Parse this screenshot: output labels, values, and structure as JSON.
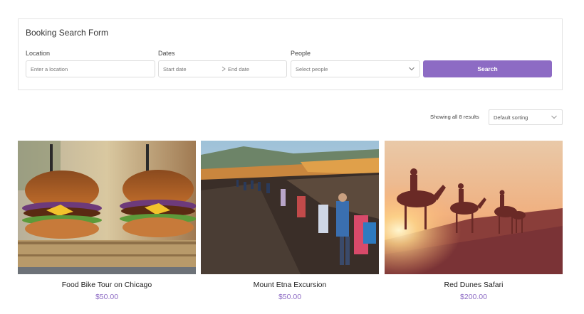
{
  "form": {
    "title": "Booking Search Form",
    "location_label": "Location",
    "location_placeholder": "Enter a location",
    "dates_label": "Dates",
    "start_placeholder": "Start date",
    "end_placeholder": "End date",
    "people_label": "People",
    "people_value": "Select people",
    "search_label": "Search"
  },
  "results": {
    "count_text": "Showing all 8 results",
    "sort_value": "Default sorting"
  },
  "listings": [
    {
      "title": "Food Bike Tour on Chicago",
      "price": "$50.00",
      "image": "burgers-photo"
    },
    {
      "title": "Mount Etna Excursion",
      "price": "$50.00",
      "image": "hikers-photo"
    },
    {
      "title": "Red Dunes Safari",
      "price": "$200.00",
      "image": "camels-sunset-photo"
    }
  ],
  "colors": {
    "accent": "#8d6bc4",
    "border": "#e3e3e3"
  }
}
